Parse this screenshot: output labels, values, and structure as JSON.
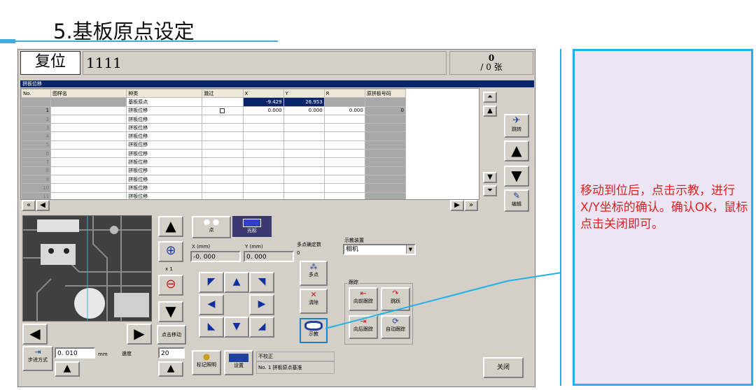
{
  "slide": {
    "title": "5.基板原点设定"
  },
  "header": {
    "reset_label": "复位",
    "program_name": "1111",
    "count_top": "0",
    "count_bottom": "/ 0 张"
  },
  "panel": {
    "title": "拼板位移"
  },
  "table": {
    "columns": [
      "No.",
      "图样名",
      "种类",
      "跳过",
      "X",
      "Y",
      "R",
      "原拼板号码"
    ],
    "origin_row": {
      "kind": "基板原点",
      "x": "-9.429",
      "y": "26.953"
    },
    "first_row": {
      "no": "1",
      "kind": "拼板位移",
      "x": "0.000",
      "y": "0.000",
      "r": "0.000",
      "orig": "0"
    },
    "rows": [
      {
        "no": "2",
        "kind": "拼板位移"
      },
      {
        "no": "3",
        "kind": "拼板位移"
      },
      {
        "no": "4",
        "kind": "拼板位移"
      },
      {
        "no": "5",
        "kind": "拼板位移"
      },
      {
        "no": "6",
        "kind": "拼板位移"
      },
      {
        "no": "7",
        "kind": "拼板位移"
      },
      {
        "no": "8",
        "kind": "拼板位移"
      },
      {
        "no": "9",
        "kind": "拼板位移"
      },
      {
        "no": "10",
        "kind": "拼板位移"
      },
      {
        "no": "11",
        "kind": "拼板位移"
      }
    ]
  },
  "side": {
    "jump_label": "跳转",
    "edit_label": "编辑"
  },
  "camera": {
    "zoom": "x 1",
    "point_move": "点击移动",
    "step_mode": "步进方式",
    "step_value": "0. 010",
    "unit": "mm",
    "speed_label": "速度",
    "speed_value": "20"
  },
  "tabs": {
    "point": "点",
    "light": "光标"
  },
  "coords": {
    "x_label": "X (mm)",
    "y_label": "Y (mm)",
    "x_value": "-0. 000",
    "y_value": "0. 000",
    "multi_count_label": "多点确定数",
    "multi_count_value": "0"
  },
  "actions": {
    "multi": "多点",
    "clear": "清除",
    "teach": "示教",
    "mark_light": "标记照明",
    "settings": "设置"
  },
  "status": {
    "line1": "不校正",
    "line2": "No. 1 拼板原点基准"
  },
  "teach_device": {
    "label": "示教装置",
    "value": "相机"
  },
  "track": {
    "label": "跟踪",
    "forward": "向前跟踪",
    "jump": "跳跃",
    "backward": "向后跟踪",
    "auto": "自动跟踪"
  },
  "close_label": "关闭",
  "annotation": {
    "text": "移动到位后，点击示教，进行X/Y坐标的确认。确认OK，鼠标点击关闭即可。"
  }
}
